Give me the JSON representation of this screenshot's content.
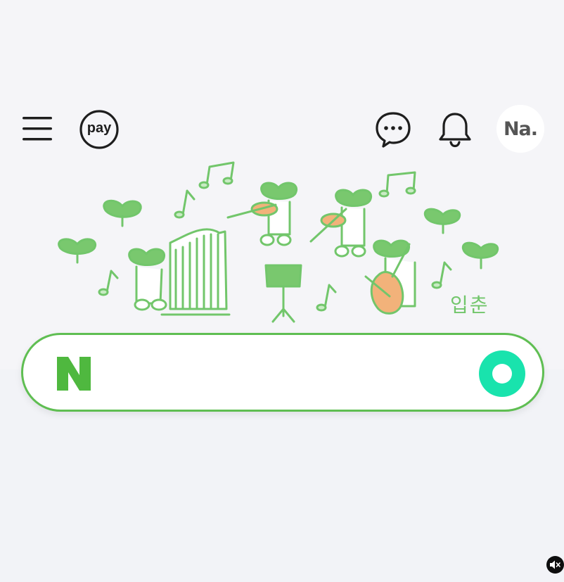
{
  "header": {
    "pay_label": "pay",
    "profile_label": "Na."
  },
  "doodle": {
    "caption": "입춘"
  },
  "search": {
    "placeholder": ""
  },
  "icons": {
    "menu": "hamburger-icon",
    "pay": "pay-icon",
    "talk": "chat-bubble-icon",
    "notifications": "bell-icon",
    "logo": "naver-n-icon",
    "search": "green-search-circle-icon",
    "mute": "speaker-muted-icon"
  },
  "colors": {
    "accent_green": "#5fbe52",
    "search_button": "#19e3ad",
    "icon_dark": "#1e1e1e",
    "doodle_green": "#72c66b"
  }
}
